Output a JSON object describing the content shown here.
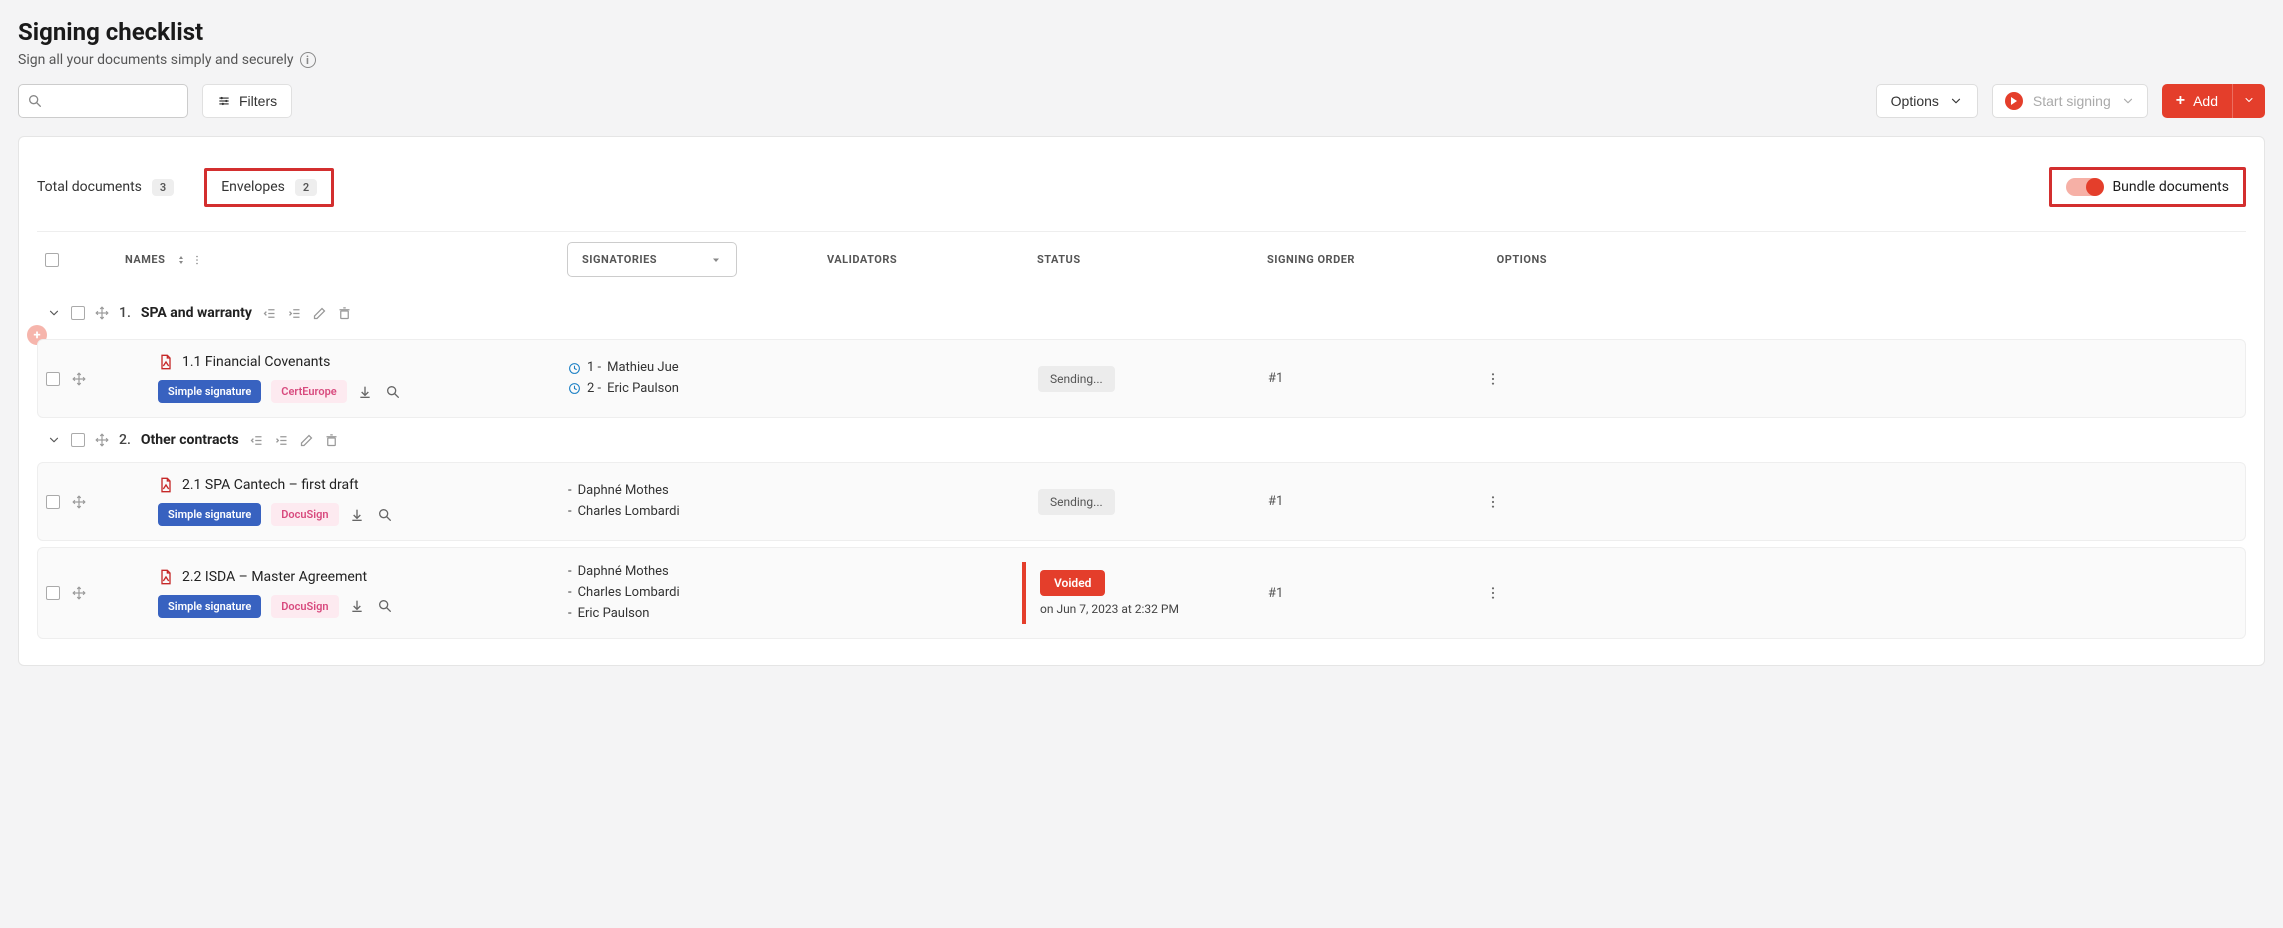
{
  "page": {
    "title": "Signing checklist",
    "subtitle": "Sign all your documents simply and securely"
  },
  "toolbar": {
    "filters_label": "Filters",
    "options_label": "Options",
    "start_signing_label": "Start signing",
    "add_label": "Add"
  },
  "tabs": {
    "total_documents_label": "Total documents",
    "total_documents_count": "3",
    "envelopes_label": "Envelopes",
    "envelopes_count": "2",
    "bundle_label": "Bundle documents"
  },
  "table": {
    "headers": {
      "names": "NAMES",
      "signatories": "SIGNATORIES",
      "validators": "VALIDATORS",
      "status": "STATUS",
      "signing_order": "SIGNING ORDER",
      "options": "OPTIONS"
    }
  },
  "groups": [
    {
      "num": "1.",
      "title": "SPA and warranty",
      "docs": [
        {
          "name": "1.1 Financial Covenants",
          "sig_type": "Simple signature",
          "provider": "CertEurope",
          "signatories": [
            {
              "prefix": "1 -",
              "name": "Mathieu Jue",
              "clock": true
            },
            {
              "prefix": "2 -",
              "name": "Eric Paulson",
              "clock": true
            }
          ],
          "status": {
            "kind": "grey",
            "label": "Sending...",
            "ts": ""
          },
          "order": "#1"
        }
      ]
    },
    {
      "num": "2.",
      "title": "Other contracts",
      "docs": [
        {
          "name": "2.1 SPA Cantech – first draft",
          "sig_type": "Simple signature",
          "provider": "DocuSign",
          "signatories": [
            {
              "prefix": "-",
              "name": "Daphné Mothes",
              "clock": false
            },
            {
              "prefix": "-",
              "name": "Charles Lombardi",
              "clock": false
            }
          ],
          "status": {
            "kind": "grey",
            "label": "Sending...",
            "ts": ""
          },
          "order": "#1"
        },
        {
          "name": "2.2 ISDA – Master Agreement",
          "sig_type": "Simple signature",
          "provider": "DocuSign",
          "signatories": [
            {
              "prefix": "-",
              "name": "Daphné Mothes",
              "clock": false
            },
            {
              "prefix": "-",
              "name": "Charles Lombardi",
              "clock": false
            },
            {
              "prefix": "-",
              "name": "Eric Paulson",
              "clock": false
            }
          ],
          "status": {
            "kind": "red",
            "label": "Voided",
            "ts": "on Jun 7, 2023 at 2:32 PM"
          },
          "order": "#1"
        }
      ]
    }
  ]
}
